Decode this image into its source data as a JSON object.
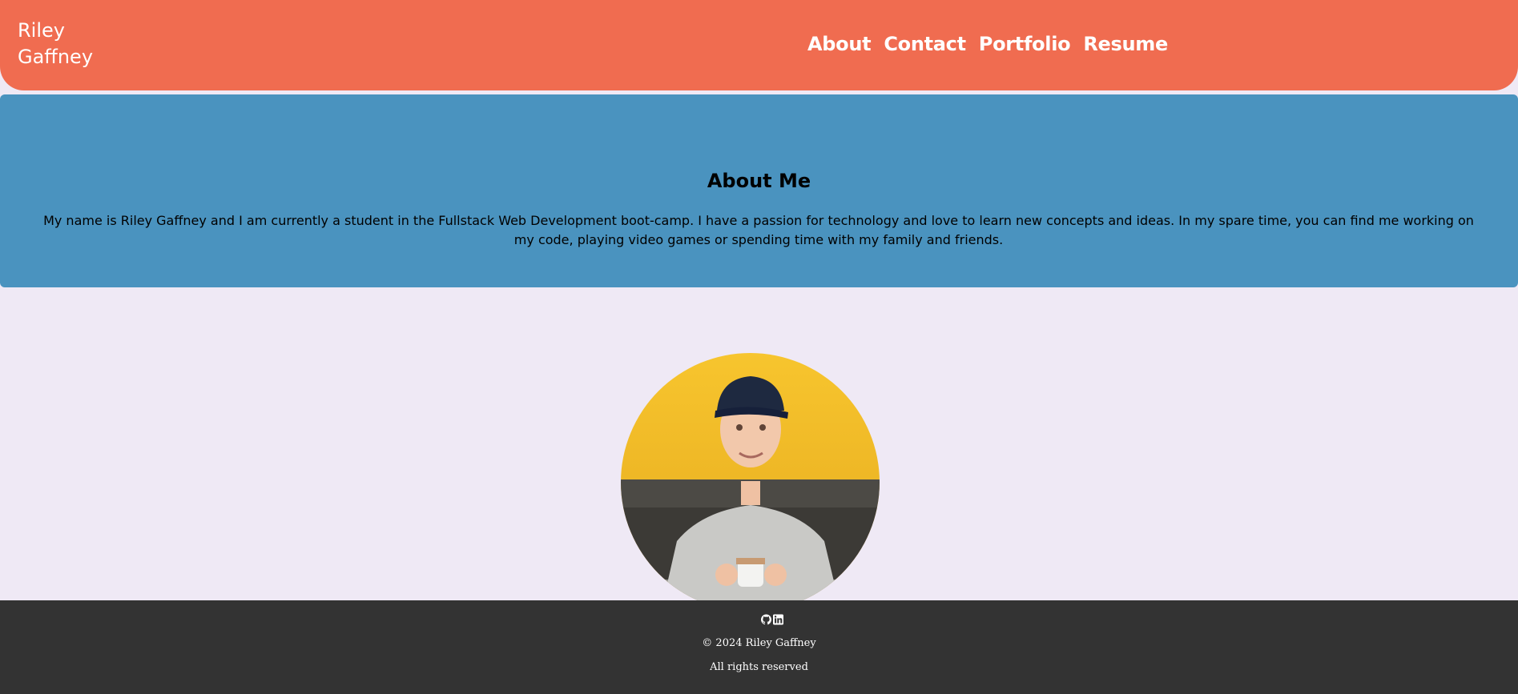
{
  "header": {
    "brand": "Riley Gaffney",
    "nav": [
      "About",
      "Contact",
      "Portfolio",
      "Resume"
    ]
  },
  "about": {
    "title": "About Me",
    "body": "My name is Riley Gaffney and I am currently a student in the Fullstack Web Development boot-camp. I have a passion for technology and love to learn new concepts and ideas. In my spare time, you can find me working on my code, playing video games or spending time with my family and friends."
  },
  "profile_image": {
    "alt": "Riley Gaffney"
  },
  "footer": {
    "icons": [
      "github-icon",
      "linkedin-icon"
    ],
    "copyright": "© 2024 Riley Gaffney",
    "rights": "All rights reserved"
  },
  "colors": {
    "header_bg": "#f06c50",
    "about_bg": "#4a93bf",
    "page_bg": "#efe9f5",
    "footer_bg": "#333333"
  }
}
